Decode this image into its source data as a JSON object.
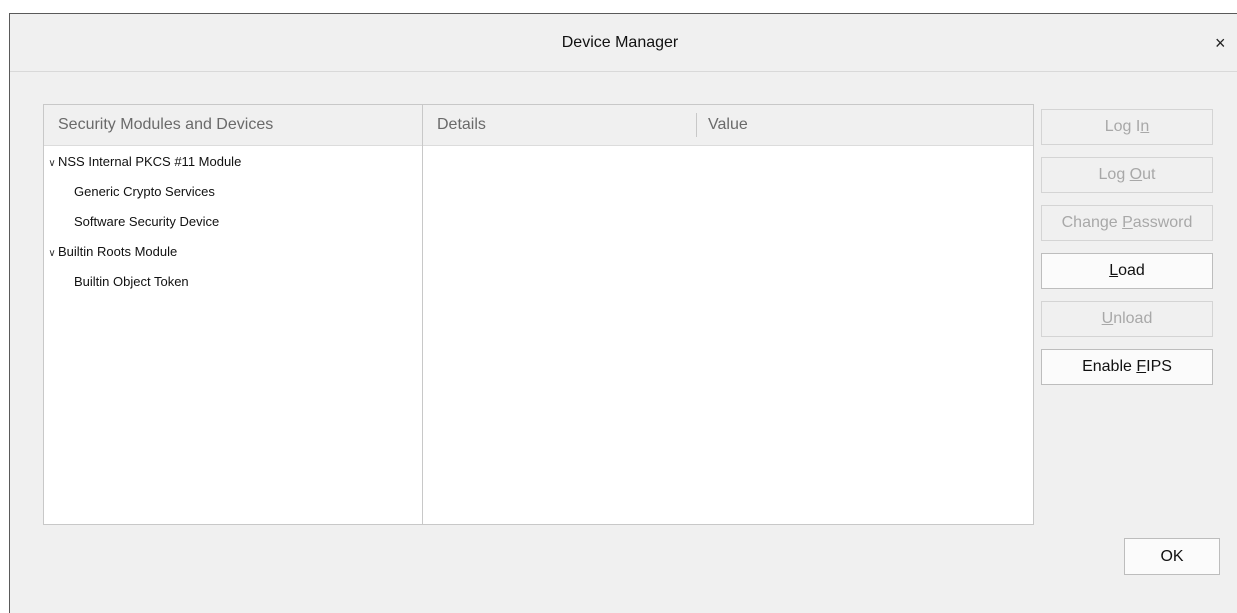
{
  "window": {
    "title": "Device Manager",
    "close_glyph": "×"
  },
  "tree": {
    "header": "Security Modules and Devices",
    "rows": [
      {
        "label": "NSS Internal PKCS #11 Module",
        "level": 0,
        "expanded": true
      },
      {
        "label": "Generic Crypto Services",
        "level": 1
      },
      {
        "label": "Software Security Device",
        "level": 1
      },
      {
        "label": "Builtin Roots Module",
        "level": 0,
        "expanded": true
      },
      {
        "label": "Builtin Object Token",
        "level": 1
      }
    ]
  },
  "details": {
    "col_details": "Details",
    "col_value": "Value"
  },
  "buttons": {
    "login": {
      "before": "Log I",
      "access": "n",
      "after": "",
      "enabled": false
    },
    "logout": {
      "before": "Log ",
      "access": "O",
      "after": "ut",
      "enabled": false
    },
    "change_password": {
      "before": "Change ",
      "access": "P",
      "after": "assword",
      "enabled": false
    },
    "load": {
      "before": "",
      "access": "L",
      "after": "oad",
      "enabled": true
    },
    "unload": {
      "before": "",
      "access": "U",
      "after": "nload",
      "enabled": false
    },
    "enable_fips": {
      "before": "Enable ",
      "access": "F",
      "after": "IPS",
      "enabled": true
    }
  },
  "ok_label": "OK",
  "icons": {
    "expanded_twisty": "chevron-down-icon",
    "close": "close-icon"
  },
  "colors": {
    "dialog_bg": "#f0f0f0",
    "disabled_text": "#a8a8a8",
    "enabled_text": "#111111"
  }
}
